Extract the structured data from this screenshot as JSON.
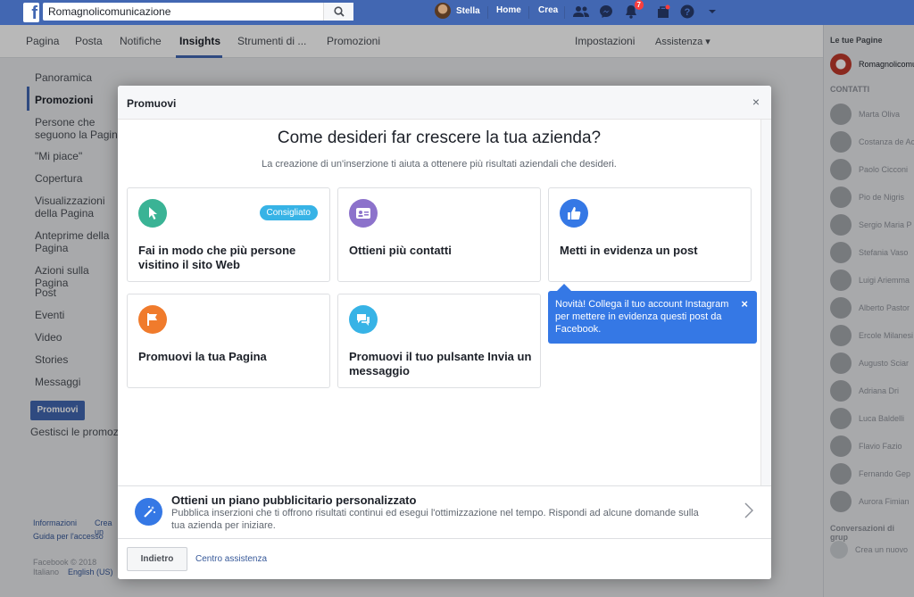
{
  "topbar": {
    "search_value": "Romagnolicomunicazione",
    "user_name": "Stella",
    "home": "Home",
    "create": "Crea",
    "notifications_count": "7"
  },
  "page_nav": {
    "items": [
      "Pagina",
      "Posta",
      "Notifiche",
      "Insights",
      "Strumenti di ...",
      "Promozioni"
    ],
    "active": "Insights",
    "settings": "Impostazioni",
    "help": "Assistenza ▾"
  },
  "left_nav": {
    "items": [
      "Panoramica",
      "Promozioni",
      "Persone che seguono la Pagina",
      "\"Mi piace\"",
      "Copertura",
      "Visualizzazioni della Pagina",
      "Anteprime della Pagina",
      "Azioni sulla Pagina",
      "Post",
      "Eventi",
      "Video",
      "Stories",
      "Messaggi"
    ],
    "promote_button": "Promuovi",
    "manage_link": "Gestisci le promozioni"
  },
  "footer": {
    "info": "Informazioni",
    "create": "Crea un",
    "access_guide": "Guida per l'accesso",
    "copyright": "Facebook © 2018",
    "lang_current": "Italiano",
    "lang_alt": "English (US)"
  },
  "right_col": {
    "your_pages": "Le tue Pagine",
    "page_name": "Romagnolicomunicazione",
    "contacts_title": "CONTATTI",
    "contacts": [
      "Marta Oliva",
      "Costanza de Ac",
      "Paolo Cicconi",
      "Pio de Nigris",
      "Sergio Maria P",
      "Stefania Vaso",
      "Luigi Ariemma",
      "Alberto Pastor",
      "Ercole Milanesi",
      "Augusto Sciar",
      "Adriana Dri",
      "Luca Baldelli",
      "Flavio Fazio",
      "Fernando Gep",
      "Aurora Fimian"
    ],
    "group_conv": "Conversazioni di grup",
    "create_new": "Crea un nuovo"
  },
  "modal": {
    "title": "Promuovi",
    "close": "×",
    "heading": "Come desideri far crescere la tua azienda?",
    "subheading": "La creazione di un'inserzione ti aiuta a ottenere più risultati aziendali che desideri.",
    "cards": [
      {
        "label": "Fai in modo che più persone visitino il sito Web",
        "badge": "Consigliato",
        "icon": "cursor-icon",
        "color": "#3ab395"
      },
      {
        "label": "Ottieni più contatti",
        "icon": "contact-card-icon",
        "color": "#8c72cb"
      },
      {
        "label": "Metti in evidenza un post",
        "icon": "thumbs-up-icon",
        "color": "#3578e5"
      },
      {
        "label": "Promuovi la tua Pagina",
        "icon": "flag-icon",
        "color": "#f07b2c"
      },
      {
        "label": "Promuovi il tuo pulsante Invia un messaggio",
        "icon": "message-icon",
        "color": "#37b3e6"
      }
    ],
    "tooltip": "Novità! Collega il tuo account Instagram per mettere in evidenza questi post da Facebook.",
    "tooltip_close": "×",
    "plan_title": "Ottieni un piano pubblicitario personalizzato",
    "plan_desc": "Pubblica inserzioni che ti offrono risultati continui ed esegui l'ottimizzazione nel tempo. Rispondi ad alcune domande sulla tua azienda per iniziare.",
    "back_button": "Indietro",
    "help_link": "Centro assistenza"
  }
}
